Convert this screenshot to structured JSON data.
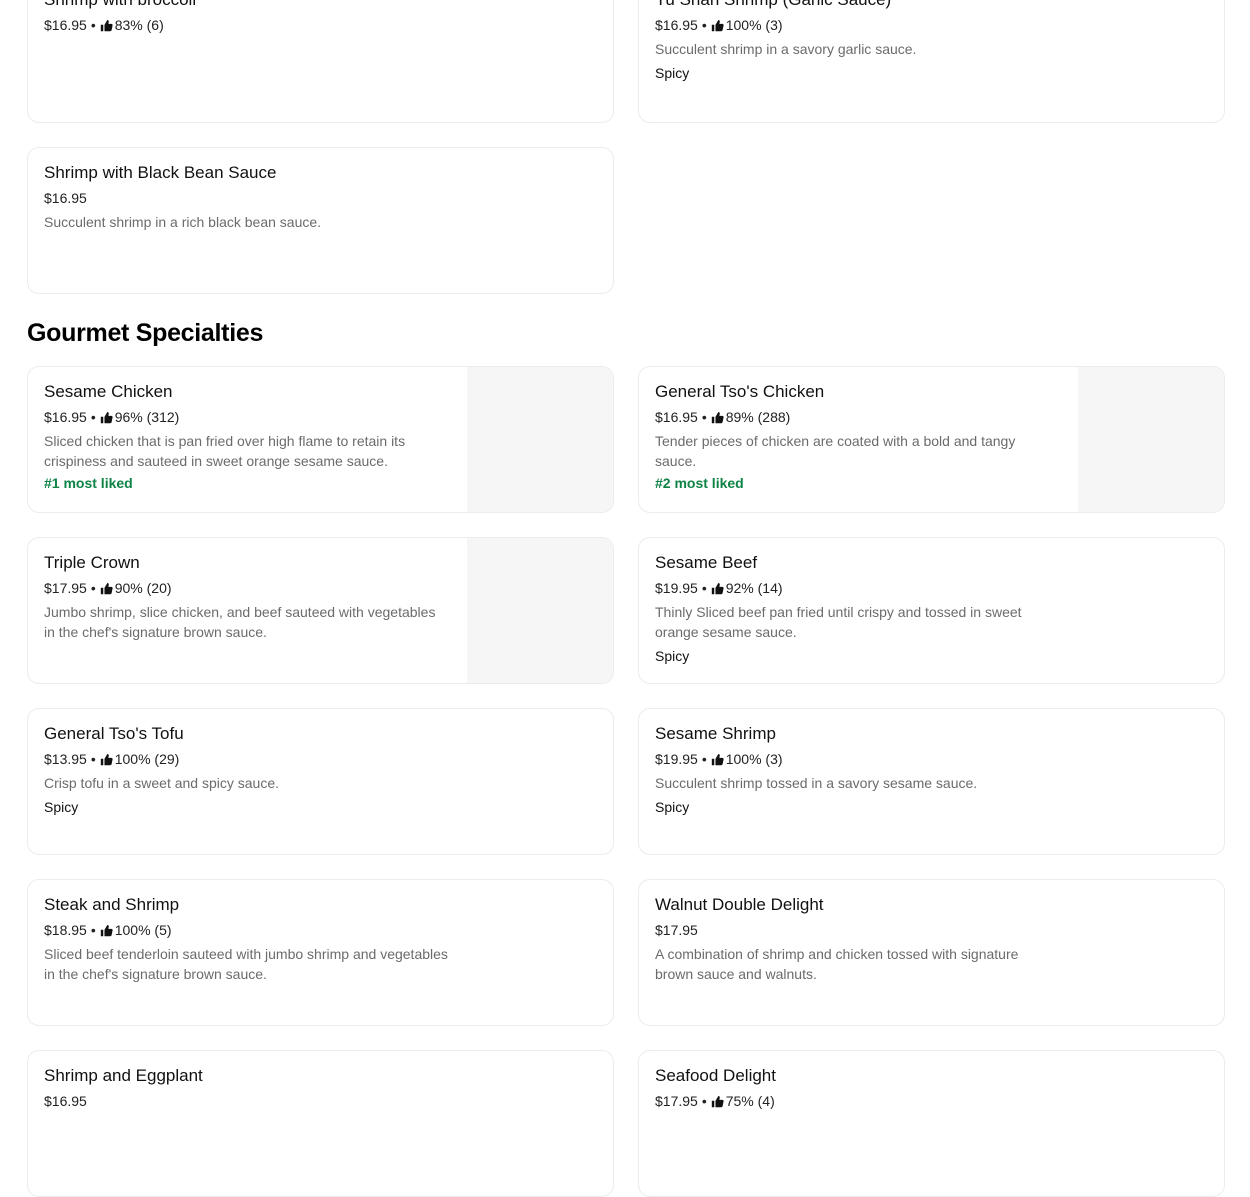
{
  "section_title": "Gourmet Specialties",
  "items": {
    "shrimp_broccoli": {
      "name": "Shrimp with broccoli",
      "price": "$16.95",
      "rating": "83% (6)"
    },
    "yu_shan_shrimp": {
      "name": "Yu Shan Shrimp (Garlic Sauce)",
      "price": "$16.95",
      "rating": "100% (3)",
      "description": "Succulent shrimp in a savory garlic sauce.",
      "tag": "Spicy"
    },
    "shrimp_black_bean": {
      "name": "Shrimp with Black Bean Sauce",
      "price": "$16.95",
      "description": "Succulent shrimp in a rich black bean sauce."
    },
    "sesame_chicken": {
      "name": "Sesame Chicken",
      "price": "$16.95",
      "rating": "96% (312)",
      "description": "Sliced chicken that is pan fried over high flame to retain its crispiness and sauteed in sweet orange sesame sauce.",
      "rank": "#1 most liked"
    },
    "general_tso_chicken": {
      "name": "General Tso's Chicken",
      "price": "$16.95",
      "rating": "89% (288)",
      "description": "Tender pieces of chicken are coated with a bold and tangy sauce.",
      "rank": "#2 most liked"
    },
    "triple_crown": {
      "name": "Triple Crown",
      "price": "$17.95",
      "rating": "90% (20)",
      "description": "Jumbo shrimp, slice chicken, and beef sauteed with vegetables in the chef's signature brown sauce."
    },
    "sesame_beef": {
      "name": "Sesame Beef",
      "price": "$19.95",
      "rating": "92% (14)",
      "description": "Thinly Sliced beef pan fried until crispy and tossed in sweet orange sesame sauce.",
      "tag": "Spicy"
    },
    "general_tso_tofu": {
      "name": "General Tso's Tofu",
      "price": "$13.95",
      "rating": "100% (29)",
      "description": "Crisp tofu in a sweet and spicy sauce.",
      "tag": "Spicy"
    },
    "sesame_shrimp": {
      "name": "Sesame Shrimp",
      "price": "$19.95",
      "rating": "100% (3)",
      "description": "Succulent shrimp tossed in a savory sesame sauce.",
      "tag": "Spicy"
    },
    "steak_shrimp": {
      "name": "Steak and Shrimp",
      "price": "$18.95",
      "rating": "100% (5)",
      "description": "Sliced beef tenderloin sauteed with jumbo shrimp and vegetables in the chef's signature brown sauce."
    },
    "walnut_double_delight": {
      "name": "Walnut Double Delight",
      "price": "$17.95",
      "description": "A combination of shrimp and chicken tossed with signature brown sauce and walnuts."
    },
    "shrimp_eggplant": {
      "name": "Shrimp and Eggplant",
      "price": "$16.95"
    },
    "seafood_delight": {
      "name": "Seafood Delight",
      "price": "$17.95",
      "rating": "75% (4)"
    }
  },
  "separator": "•",
  "colors": {
    "rank_green": "#0e8345",
    "description_gray": "#6b6b6b",
    "card_border": "#ececec"
  },
  "icons": {
    "rating": "thumbs-up-icon"
  }
}
